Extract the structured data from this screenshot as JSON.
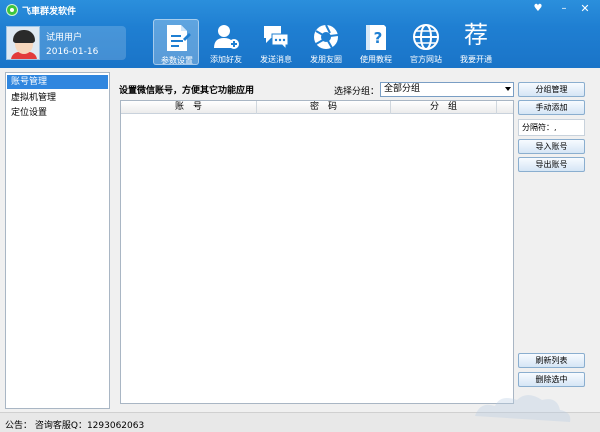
{
  "app": {
    "title": "飞車群发软件"
  },
  "window_controls": {
    "skin": "♥",
    "minimize": "–",
    "close": "✕"
  },
  "user": {
    "name": "试用用户",
    "date": "2016-01-16"
  },
  "toolbar": [
    {
      "label": "参数设置",
      "icon": "gear-document-icon",
      "active": true
    },
    {
      "label": "添加好友",
      "icon": "add-user-icon"
    },
    {
      "label": "发送消息",
      "icon": "chat-bubbles-icon"
    },
    {
      "label": "发朋友圈",
      "icon": "camera-shutter-icon"
    },
    {
      "label": "使用教程",
      "icon": "help-book-icon"
    },
    {
      "label": "官方网站",
      "icon": "globe-icon"
    },
    {
      "label": "我要开通",
      "icon": "recommend-icon",
      "glyph": "荐"
    }
  ],
  "sidebar": {
    "items": [
      {
        "label": "账号管理",
        "selected": true
      },
      {
        "label": "虚拟机管理"
      },
      {
        "label": "定位设置"
      }
    ]
  },
  "main": {
    "description": "设置微信账号，方便其它功能应用",
    "group_label": "选择分组：",
    "group_selected": "全部分组",
    "table": {
      "columns": [
        "账　号",
        "密　码",
        "分　组"
      ],
      "rows": []
    },
    "buttons": {
      "group_manage": "分组管理",
      "manual_add": "手动添加",
      "separator": "分隔符：,",
      "import": "导入账号",
      "export": "导出账号",
      "refresh": "刷新列表",
      "delete": "删除选中"
    }
  },
  "statusbar": {
    "text": "公告：  咨询客服Q：1293062063"
  },
  "colors": {
    "header": "#1f7fd2",
    "selected": "#2f86df",
    "button_border": "#8aaecf"
  }
}
